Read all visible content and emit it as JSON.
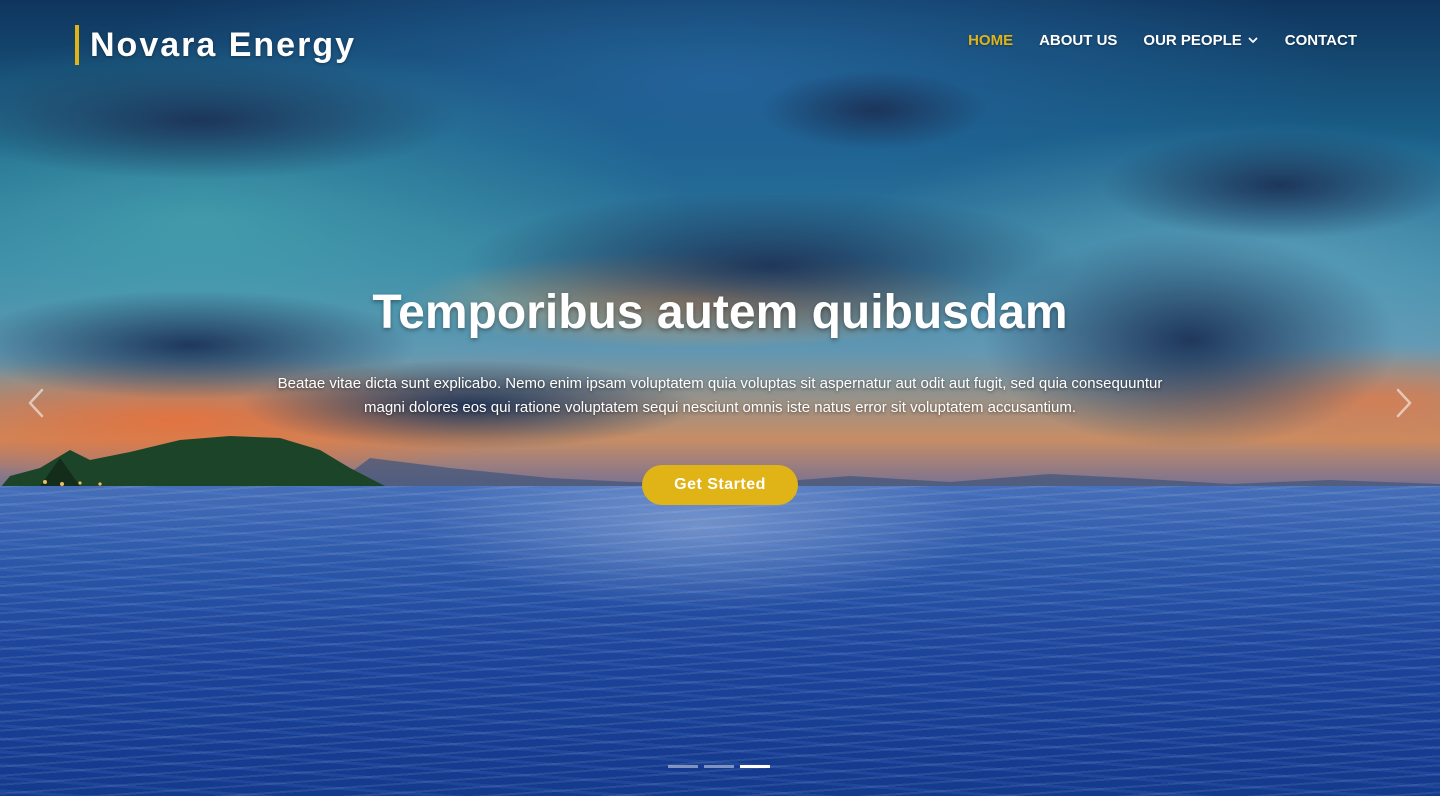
{
  "brand": {
    "name": "Novara Energy",
    "accent_color": "#e0b416"
  },
  "nav": {
    "items": [
      {
        "label": "HOME",
        "active": true
      },
      {
        "label": "ABOUT US",
        "active": false
      },
      {
        "label": "OUR PEOPLE",
        "active": false,
        "has_dropdown": true
      },
      {
        "label": "CONTACT",
        "active": false
      }
    ]
  },
  "hero": {
    "title": "Temporibus autem quibusdam",
    "text": "Beatae vitae dicta sunt explicabo. Nemo enim ipsam voluptatem quia voluptas sit aspernatur aut odit aut fugit, sed quia consequuntur magni dolores eos qui ratione voluptatem sequi nesciunt omnis iste natus error sit voluptatem accusantium.",
    "cta_label": "Get Started"
  },
  "carousel": {
    "prev_icon": "chevron-left-icon",
    "next_icon": "chevron-right-icon",
    "slide_count": 3,
    "active_slide": 3
  },
  "background": {
    "image": "sunset-ocean-clouds"
  }
}
